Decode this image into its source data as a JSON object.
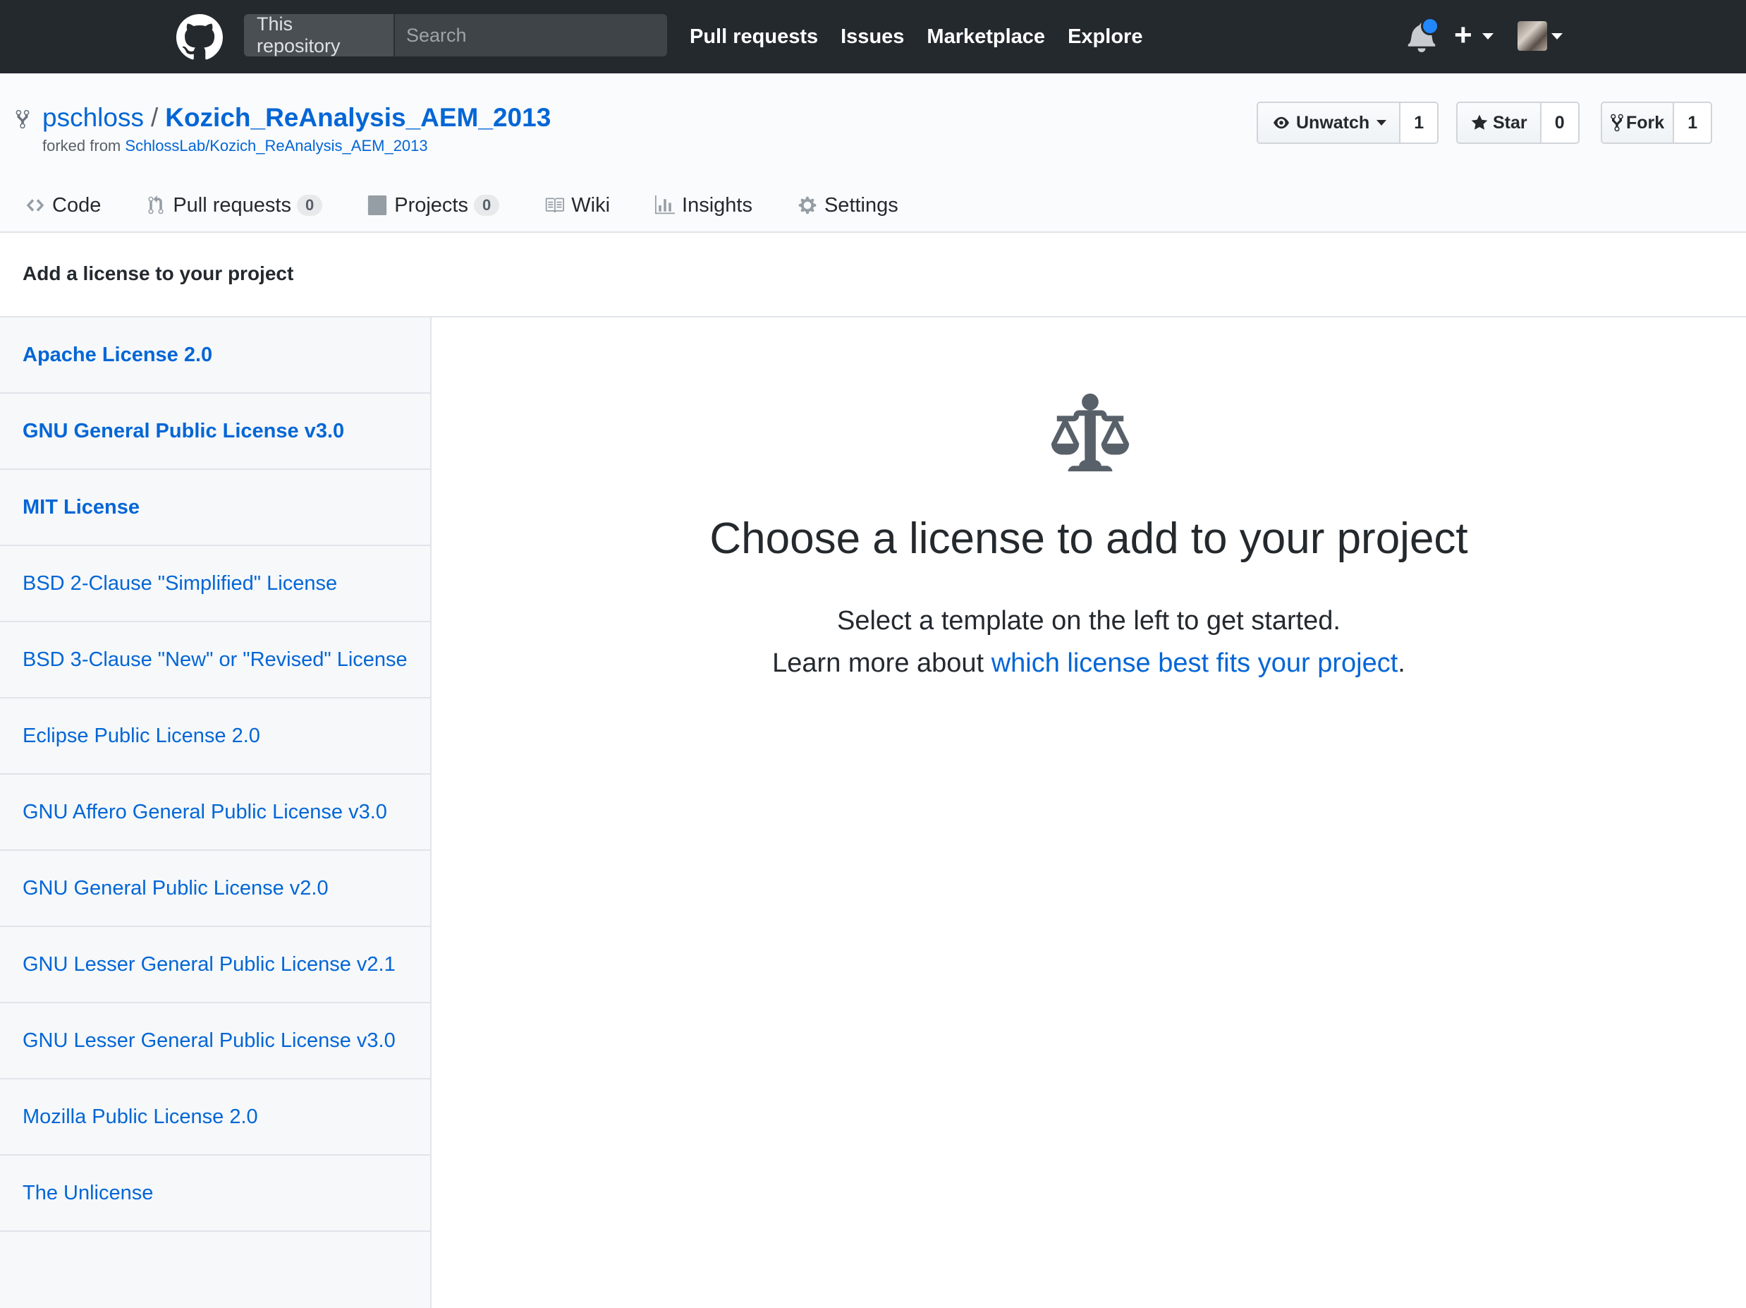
{
  "header": {
    "search": {
      "scope": "This repository",
      "placeholder": "Search"
    },
    "nav": [
      "Pull requests",
      "Issues",
      "Marketplace",
      "Explore"
    ],
    "icons": [
      "github-logo-icon",
      "bell-icon",
      "plus-icon",
      "avatar"
    ]
  },
  "repo": {
    "owner": "pschloss",
    "separator": "/",
    "name": "Kozich_ReAnalysis_AEM_2013",
    "forked_prefix": "forked from",
    "forked_from": "SchlossLab/Kozich_ReAnalysis_AEM_2013",
    "actions": {
      "watch": {
        "label": "Unwatch",
        "count": "1"
      },
      "star": {
        "label": "Star",
        "count": "0"
      },
      "fork": {
        "label": "Fork",
        "count": "1"
      }
    },
    "tabs": [
      {
        "label": "Code",
        "icon": "code-icon"
      },
      {
        "label": "Pull requests",
        "count": "0",
        "icon": "pull-request-icon"
      },
      {
        "label": "Projects",
        "count": "0",
        "icon": "project-icon"
      },
      {
        "label": "Wiki",
        "icon": "book-icon"
      },
      {
        "label": "Insights",
        "icon": "graph-icon"
      },
      {
        "label": "Settings",
        "icon": "gear-icon"
      }
    ]
  },
  "page": {
    "subhead": "Add a license to your project",
    "licenses": [
      "Apache License 2.0",
      "GNU General Public License v3.0",
      "MIT License",
      "BSD 2-Clause \"Simplified\" License",
      "BSD 3-Clause \"New\" or \"Revised\" License",
      "Eclipse Public License 2.0",
      "GNU Affero General Public License v3.0",
      "GNU General Public License v2.0",
      "GNU Lesser General Public License v2.1",
      "GNU Lesser General Public License v3.0",
      "Mozilla Public License 2.0",
      "The Unlicense"
    ],
    "empty": {
      "title": "Choose a license to add to your project",
      "line1": "Select a template on the left to get started.",
      "line2_prefix": "Learn more about",
      "line2_link": "which license best fits your project",
      "line2_suffix": "."
    }
  },
  "colors": {
    "header_bg": "#24292e",
    "link": "#0366d6",
    "sidebar_bg": "#f6f8fa",
    "notification_dot": "#2188ff"
  }
}
